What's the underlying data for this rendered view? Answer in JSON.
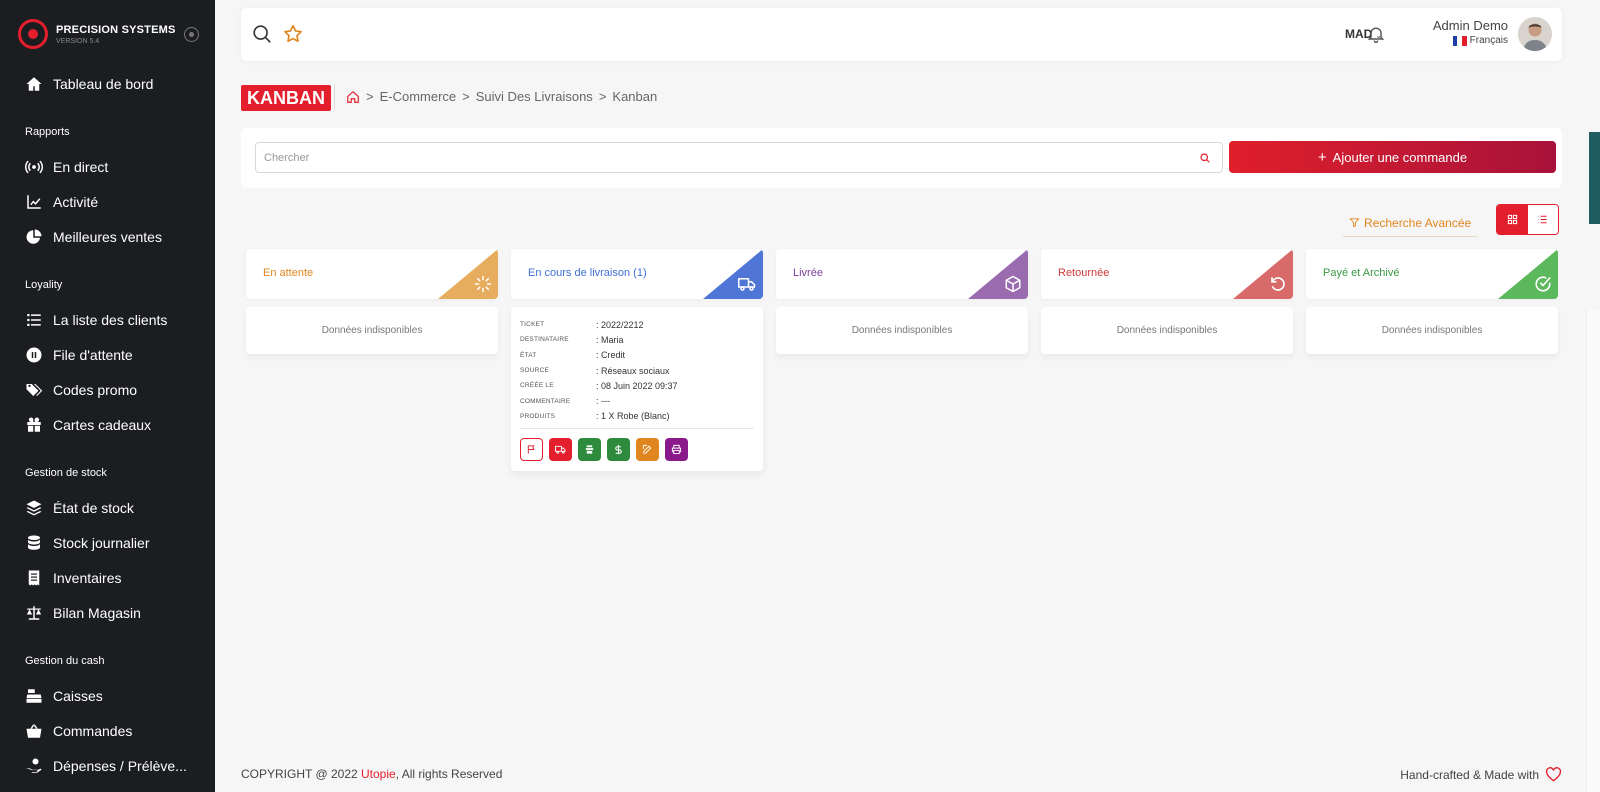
{
  "brand": {
    "name": "PRECISION SYSTEMS",
    "version": "VERSION 5.4"
  },
  "sidebar": {
    "dashboard": {
      "label": "Tableau de bord",
      "icon": "home-icon"
    },
    "sections": [
      {
        "title": "Rapports",
        "items": [
          {
            "label": "En direct",
            "icon": "broadcast-icon"
          },
          {
            "label": "Activité",
            "icon": "chart-line-icon"
          },
          {
            "label": "Meilleures ventes",
            "icon": "pie-chart-icon"
          }
        ]
      },
      {
        "title": "Loyality",
        "items": [
          {
            "label": "La liste des clients",
            "icon": "list-icon"
          },
          {
            "label": "File d'attente",
            "icon": "pause-icon"
          },
          {
            "label": "Codes promo",
            "icon": "tags-icon"
          },
          {
            "label": "Cartes cadeaux",
            "icon": "gift-icon"
          }
        ]
      },
      {
        "title": "Gestion de stock",
        "items": [
          {
            "label": "État de stock",
            "icon": "layers-icon"
          },
          {
            "label": "Stock journalier",
            "icon": "database-icon"
          },
          {
            "label": "Inventaires",
            "icon": "receipt-icon"
          },
          {
            "label": "Bilan Magasin",
            "icon": "balance-icon"
          }
        ]
      },
      {
        "title": "Gestion du cash",
        "items": [
          {
            "label": "Caisses",
            "icon": "cash-register-icon"
          },
          {
            "label": "Commandes",
            "icon": "basket-icon"
          },
          {
            "label": "Dépenses / Prélève...",
            "icon": "hand-money-icon"
          }
        ]
      }
    ]
  },
  "topbar": {
    "currency": "MAD",
    "user_name": "Admin Demo",
    "language": "Français"
  },
  "page": {
    "title": "KANBAN",
    "breadcrumb": [
      "E-Commerce",
      "Suivi Des Livraisons",
      "Kanban"
    ]
  },
  "search": {
    "placeholder": "Chercher"
  },
  "actions": {
    "add_order": "Ajouter une commande",
    "advanced_search": "Recherche Avancée"
  },
  "columns": [
    {
      "title": "En attente",
      "color": "#e0861f",
      "tri": "#e6ad5e",
      "icon": "spinner-icon",
      "empty": "Données indisponibles"
    },
    {
      "title": "En cours de livraison (1)",
      "color": "#3f6fd6",
      "tri": "#4f76d6",
      "icon": "truck-icon",
      "empty": ""
    },
    {
      "title": "Livrée",
      "color": "#7b3f9b",
      "tri": "#9b6bb0",
      "icon": "box-icon",
      "empty": "Données indisponibles"
    },
    {
      "title": "Retournée",
      "color": "#d23a3a",
      "tri": "#d86a6a",
      "icon": "undo-icon",
      "empty": "Données indisponibles"
    },
    {
      "title": "Payé et Archivé",
      "color": "#3a9a44",
      "tri": "#5cb85c",
      "icon": "check-circle-icon",
      "empty": "Données indisponibles"
    }
  ],
  "ticket": {
    "rows": [
      {
        "label": "TICKET",
        "value": ": 2022/2212"
      },
      {
        "label": "DESTINATAIRE",
        "value": ": Maria"
      },
      {
        "label": "ÉTAT",
        "value": ": Credit"
      },
      {
        "label": "SOURCE",
        "value": ": Réseaux sociaux"
      },
      {
        "label": "CRÉÉE LE",
        "value": ": 08 Juin 2022 09:37"
      },
      {
        "label": "COMMENTAIRE",
        "value": ": ---"
      },
      {
        "label": "PRODUITS",
        "value": ": 1 X Robe (Blanc)"
      }
    ]
  },
  "footer": {
    "copyright_prefix": "COPYRIGHT @ 2022 ",
    "company": "Utopie",
    "copyright_suffix": ", All rights Reserved",
    "right_text": "Hand-crafted & Made with"
  },
  "colors": {
    "accent": "#e31e2d",
    "sidebar_bg": "#1b1d21"
  }
}
